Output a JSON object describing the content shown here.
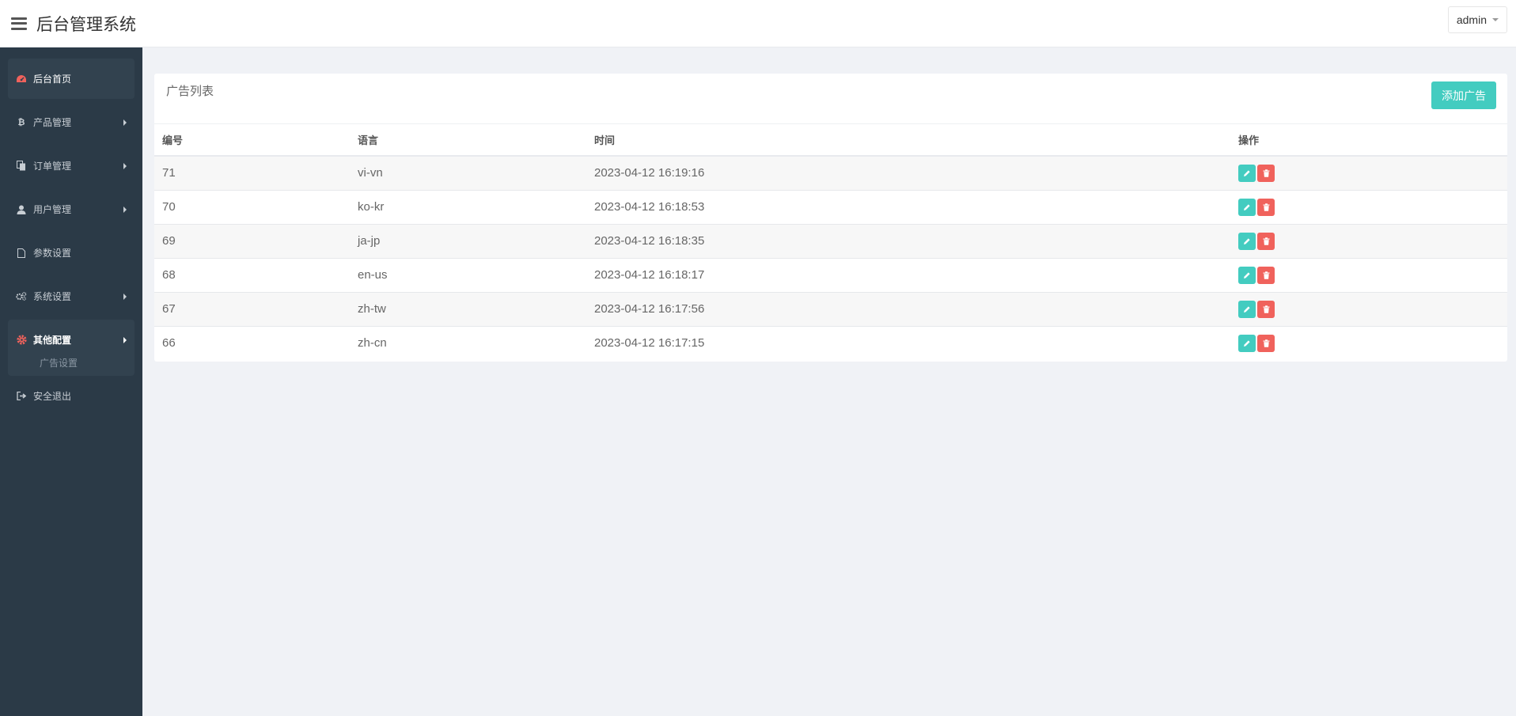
{
  "header": {
    "title": "后台管理系统",
    "user": "admin"
  },
  "sidebar": {
    "items": [
      {
        "label": "后台首页",
        "icon": "dashboard-icon"
      },
      {
        "label": "产品管理",
        "icon": "bitcoin-icon"
      },
      {
        "label": "订单管理",
        "icon": "copy-icon"
      },
      {
        "label": "用户管理",
        "icon": "user-icon"
      },
      {
        "label": "参数设置",
        "icon": "file-icon"
      },
      {
        "label": "系统设置",
        "icon": "gears-icon"
      },
      {
        "label": "其他配置",
        "icon": "gear-icon"
      },
      {
        "label": "安全退出",
        "icon": "sign-out-icon"
      }
    ],
    "submenu": {
      "label": "广告设置"
    }
  },
  "panel": {
    "title": "广告列表",
    "add_button": "添加广告"
  },
  "table": {
    "headers": [
      "编号",
      "语言",
      "时间",
      "操作"
    ],
    "rows": [
      {
        "id": "71",
        "lang": "vi-vn",
        "time": "2023-04-12 16:19:16"
      },
      {
        "id": "70",
        "lang": "ko-kr",
        "time": "2023-04-12 16:18:53"
      },
      {
        "id": "69",
        "lang": "ja-jp",
        "time": "2023-04-12 16:18:35"
      },
      {
        "id": "68",
        "lang": "en-us",
        "time": "2023-04-12 16:18:17"
      },
      {
        "id": "67",
        "lang": "zh-tw",
        "time": "2023-04-12 16:17:56"
      },
      {
        "id": "66",
        "lang": "zh-cn",
        "time": "2023-04-12 16:17:15"
      }
    ]
  },
  "colors": {
    "sidebar_bg": "#2b3a47",
    "accent": "#43ccc0",
    "danger": "#f0625c",
    "home_icon": "#f0625c"
  }
}
